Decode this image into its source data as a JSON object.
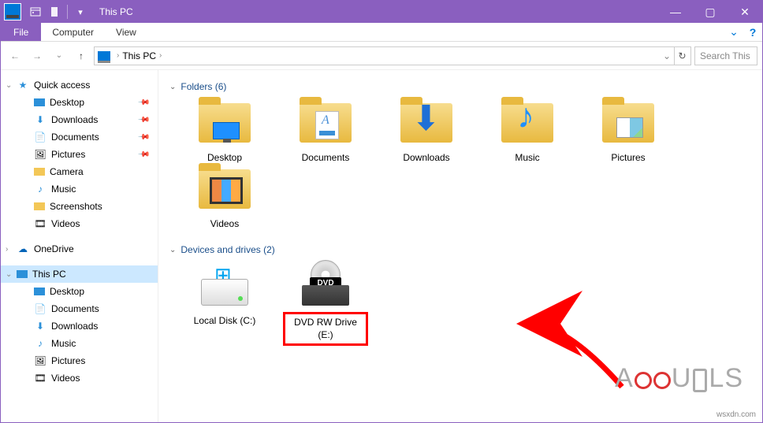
{
  "title": "This PC",
  "qat": {
    "props": "▯",
    "new": "▯",
    "dropdown": "▾"
  },
  "ribbon": {
    "file": "File",
    "computer": "Computer",
    "view": "View"
  },
  "addr": {
    "back": "←",
    "fwd": "→",
    "up": "↑",
    "location": "This PC",
    "sep": "›",
    "refresh": "↻",
    "search_placeholder": "Search This"
  },
  "nav": {
    "quick": "Quick access",
    "items_quick": [
      {
        "label": "Desktop",
        "pin": true
      },
      {
        "label": "Downloads",
        "pin": true
      },
      {
        "label": "Documents",
        "pin": true
      },
      {
        "label": "Pictures",
        "pin": true
      },
      {
        "label": "Camera",
        "pin": false
      },
      {
        "label": "Music",
        "pin": false
      },
      {
        "label": "Screenshots",
        "pin": false
      },
      {
        "label": "Videos",
        "pin": false
      }
    ],
    "onedrive": "OneDrive",
    "thispc": "This PC",
    "items_pc": [
      {
        "label": "Desktop"
      },
      {
        "label": "Documents"
      },
      {
        "label": "Downloads"
      },
      {
        "label": "Music"
      },
      {
        "label": "Pictures"
      },
      {
        "label": "Videos"
      }
    ]
  },
  "groups": {
    "folders_head": "Folders (6)",
    "folders": [
      {
        "label": "Desktop",
        "ov": "monitor"
      },
      {
        "label": "Documents",
        "ov": "doc"
      },
      {
        "label": "Downloads",
        "ov": "arrow"
      },
      {
        "label": "Music",
        "ov": "note"
      },
      {
        "label": "Pictures",
        "ov": "pic"
      },
      {
        "label": "Videos",
        "ov": "film"
      }
    ],
    "drives_head": "Devices and drives (2)",
    "drives": [
      {
        "label": "Local Disk (C:)",
        "kind": "hdd"
      },
      {
        "label": "DVD RW Drive (E:)",
        "kind": "dvd",
        "highlight": true
      }
    ]
  },
  "watermark_credit": "wsxdn.com",
  "dvd_badge": "DVD"
}
